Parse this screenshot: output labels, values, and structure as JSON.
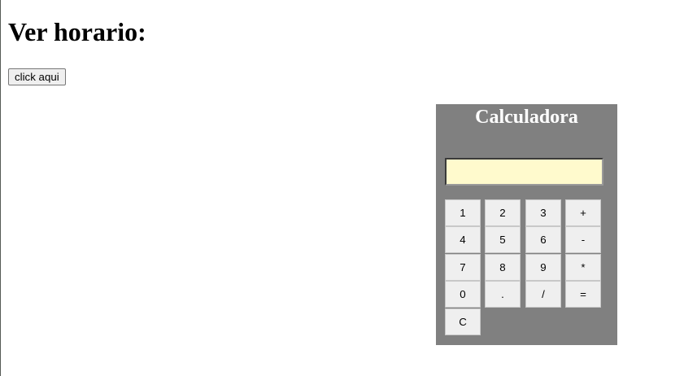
{
  "page": {
    "title": "Ver horario:",
    "button_label": "click aqui"
  },
  "calculator": {
    "title": "Calculadora",
    "display_value": "",
    "keys": [
      "1",
      "2",
      "3",
      "+",
      "4",
      "5",
      "6",
      "-",
      "7",
      "8",
      "9",
      "*",
      "0",
      ".",
      "/",
      "=",
      "C"
    ]
  },
  "colors": {
    "calculator_bg": "#808080",
    "display_bg": "#fffacd",
    "key_bg": "#efefef"
  }
}
